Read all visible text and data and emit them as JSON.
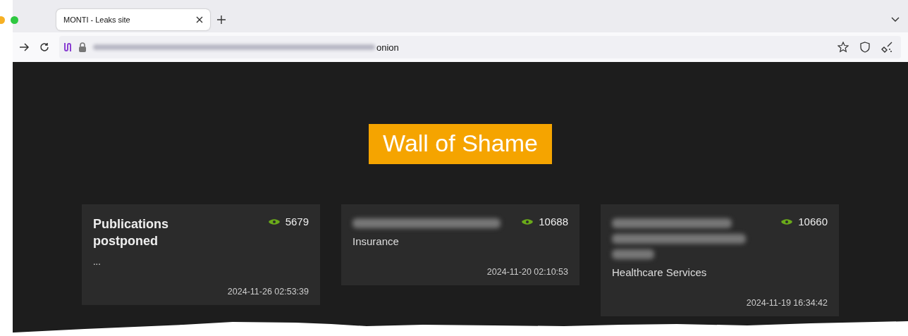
{
  "browser": {
    "tab": {
      "title": "MONTI - Leaks site",
      "selected": true
    },
    "address": {
      "visible_text": "onion"
    }
  },
  "page": {
    "heading": "Wall of Shame",
    "cards": [
      {
        "title": "Publications postponed",
        "title_blurred": false,
        "views": "5679",
        "subtitle": "...",
        "date": "2024-11-26 02:53:39"
      },
      {
        "title_blurred": true,
        "views": "10688",
        "subtitle": "Insurance",
        "date": "2024-11-20 02:10:53"
      },
      {
        "title_blurred": true,
        "views": "10660",
        "subtitle": "Healthcare Services",
        "date": "2024-11-19 16:34:42"
      }
    ]
  }
}
